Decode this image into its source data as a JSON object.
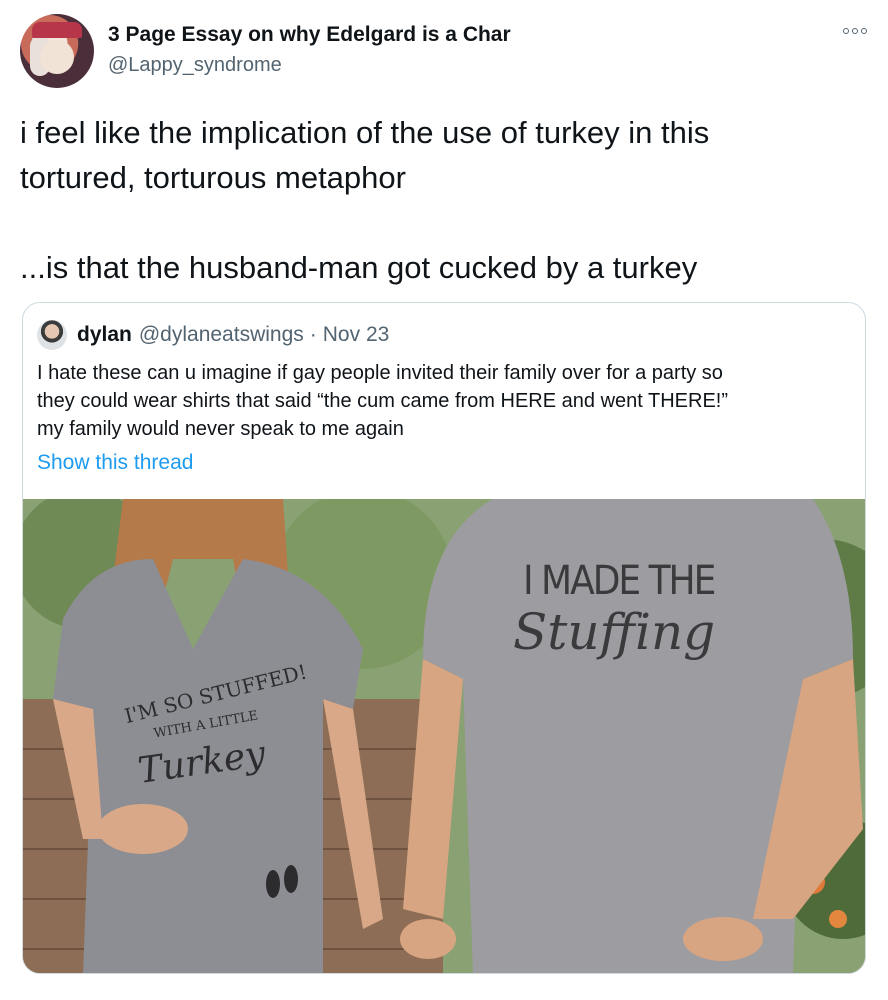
{
  "tweet": {
    "author_name": "3 Page Essay on why Edelgard is a Char",
    "author_handle": "@Lappy_syndrome",
    "text_line_1": "i feel like the implication of the use of turkey in this",
    "text_line_2": "tortured, torturous metaphor",
    "text_line_3": "...is that the husband-man got cucked by a turkey"
  },
  "quote": {
    "author_name": "dylan",
    "author_handle": "@dylaneatswings",
    "separator": "·",
    "date": "Nov 23",
    "text_line_1": "I hate these can u imagine if gay people invited their family over for a party so",
    "text_line_2": "they could wear shirts that said “the cum came from HERE and went THERE!”",
    "text_line_3": "my family would never speak to me again",
    "show_thread": "Show this thread",
    "media": {
      "shirt_left_line1": "I'M SO STUFFED!",
      "shirt_left_line2": "WITH A LITTLE",
      "shirt_left_line3": "Turkey",
      "shirt_right_line1": "I MADE THE",
      "shirt_right_line2": "Stuffing"
    }
  },
  "icons": {
    "more": "more-options-icon"
  },
  "colors": {
    "link": "#1d9bf0",
    "secondary_text": "#536471",
    "border": "#cfd9de"
  }
}
